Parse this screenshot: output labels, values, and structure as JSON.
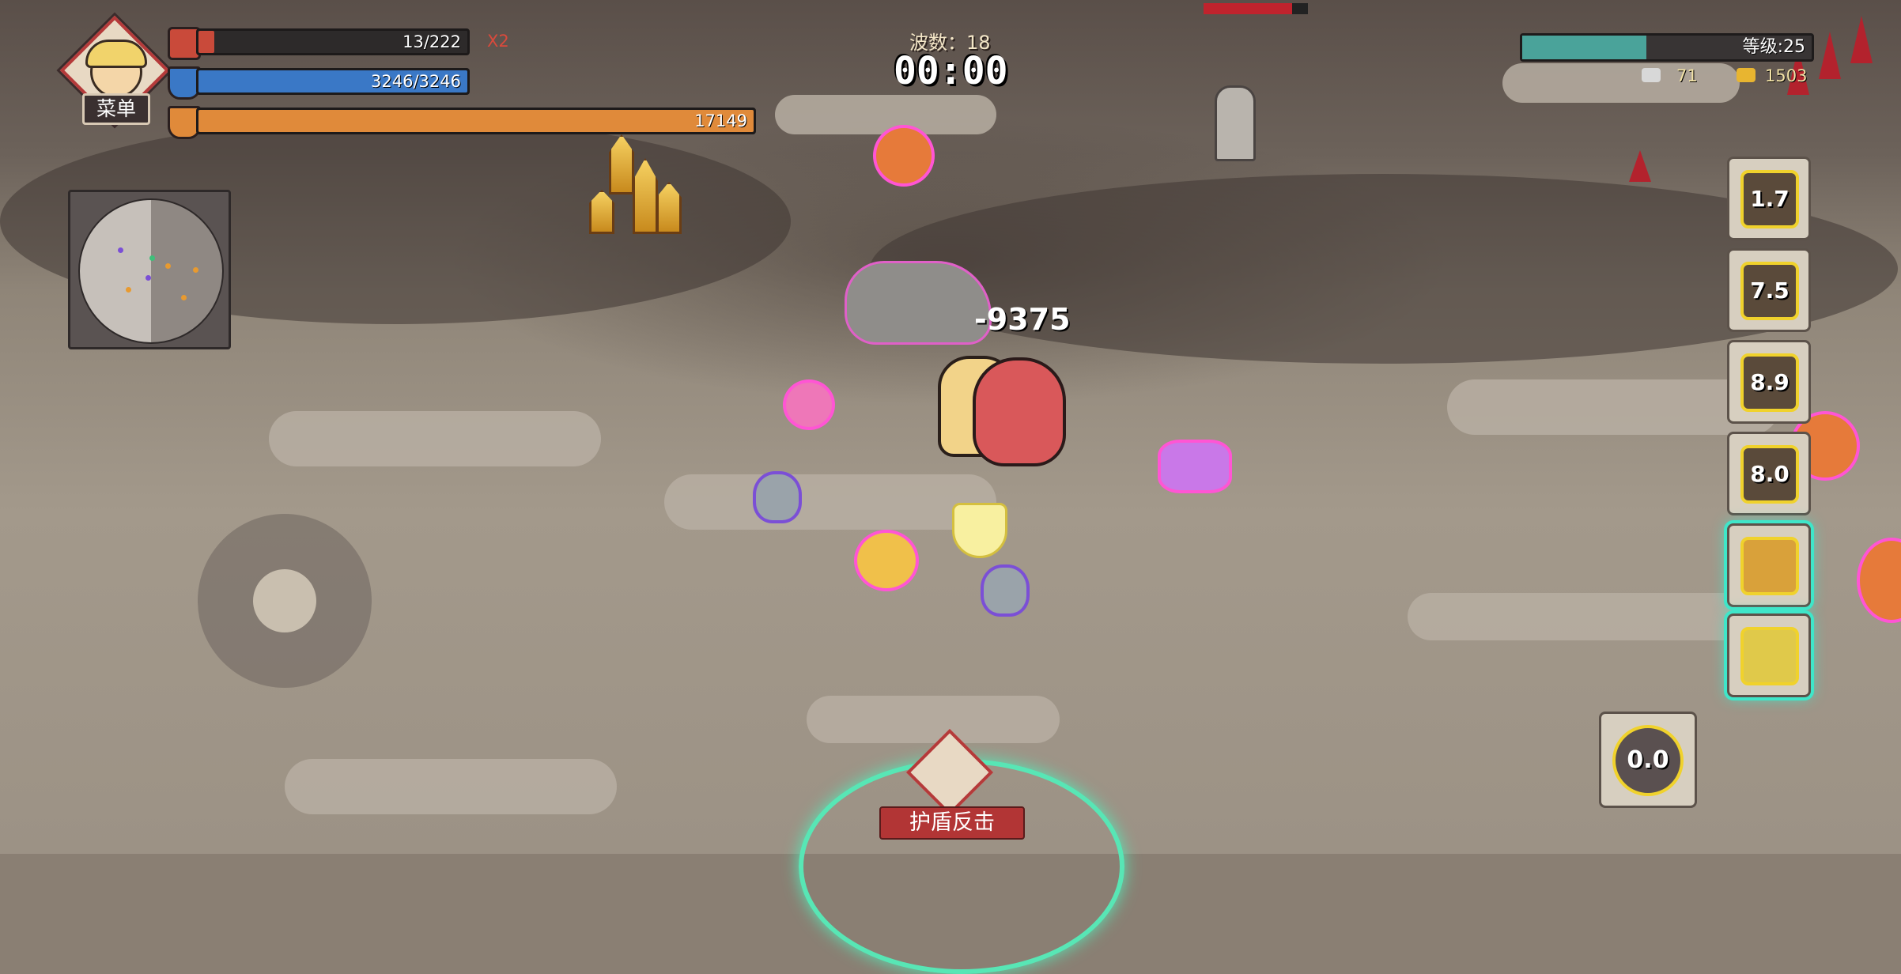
{
  "hud": {
    "menu_label": "菜单",
    "health": {
      "text": "13/222",
      "fraction": 0.06,
      "color": "#c94a3a"
    },
    "health_multiplier": "X2",
    "shield": {
      "text": "3246/3246",
      "fraction": 1.0,
      "color": "#3a78c6"
    },
    "armor": {
      "text": "17149",
      "fraction": 1.0,
      "color": "#e08a3a"
    },
    "wave_label": "波数：18",
    "timer": "00:00",
    "level_label": "等级:25",
    "level_fraction": 0.43,
    "silver_count": "71",
    "gold_count": "1503"
  },
  "skills": [
    {
      "name": "skill-1",
      "cooldown": "1.7"
    },
    {
      "name": "skill-2",
      "cooldown": "7.5"
    },
    {
      "name": "skill-3",
      "cooldown": "8.9"
    },
    {
      "name": "skill-4",
      "cooldown": "8.0"
    },
    {
      "name": "skill-5",
      "cooldown": ""
    },
    {
      "name": "skill-6",
      "cooldown": ""
    }
  ],
  "ultimate": {
    "cooldown": "0.0"
  },
  "combat": {
    "damage_popup": "-9375"
  },
  "action": {
    "shield_counter_label": "护盾反击"
  },
  "colors": {
    "level_fill": "#4aa39a",
    "skill_glow": "#3fe6c9",
    "enemy_outline": "#ff55d4"
  }
}
